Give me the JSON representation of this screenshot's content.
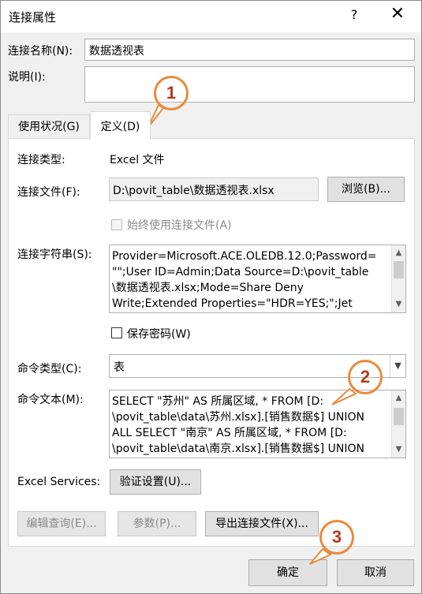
{
  "window": {
    "title": "连接属性",
    "help_label": "?",
    "close_label": "✕"
  },
  "connection_name": {
    "label": "连接名称(N):",
    "value": "数据透视表"
  },
  "description": {
    "label": "说明(I):",
    "value": ""
  },
  "tabs": [
    {
      "label": "使用状况(G)"
    },
    {
      "label": "定义(D)"
    }
  ],
  "definition": {
    "conn_type_label": "连接类型:",
    "conn_type_value": "Excel 文件",
    "conn_file_label": "连接文件(F):",
    "conn_file_value": "D:\\povit_table\\数据透视表.xlsx",
    "browse_label": "浏览(B)...",
    "always_use_label": "始终使用连接文件(A)",
    "conn_string_label": "连接字符串(S):",
    "conn_string_lines": [
      "Provider=Microsoft.ACE.OLEDB.12.0;Password=",
      "\"\";User ID=Admin;Data Source=D:\\povit_table",
      "\\数据透视表.xlsx;Mode=Share Deny",
      "Write;Extended Properties=\"HDR=YES;\";Jet"
    ],
    "save_password_label": "保存密码(W)",
    "cmd_type_label": "命令类型(C):",
    "cmd_type_value": "表",
    "cmd_text_label": "命令文本(M):",
    "cmd_text_lines": [
      "SELECT \"苏州\" AS 所属区域, * FROM [D:",
      "\\povit_table\\data\\苏州.xlsx].[销售数据$] UNION",
      "ALL SELECT \"南京\" AS 所属区域, * FROM [D:",
      "\\povit_table\\data\\南京.xlsx].[销售数据$] UNION"
    ],
    "excel_services_label": "Excel Services:",
    "auth_settings_label": "验证设置(U)...",
    "edit_query_label": "编辑查询(E)...",
    "params_label": "参数(P)...",
    "export_label": "导出连接文件(X)..."
  },
  "footer": {
    "ok_label": "确定",
    "cancel_label": "取消"
  },
  "callouts": [
    "1",
    "2",
    "3"
  ],
  "colors": {
    "callout_ring": "#e98a3c",
    "callout_text": "#b33a1f"
  }
}
